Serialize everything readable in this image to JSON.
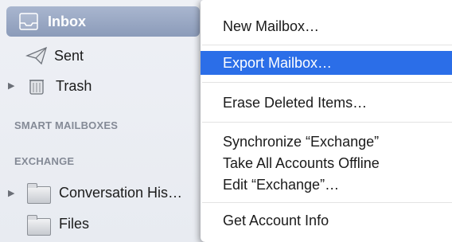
{
  "sidebar": {
    "inbox": {
      "label": "Inbox",
      "icon": "inbox-tray-icon"
    },
    "sent": {
      "label": "Sent",
      "icon": "paper-plane-icon"
    },
    "trash": {
      "label": "Trash",
      "icon": "trash-can-icon"
    },
    "smart_mailboxes_header": "SMART MAILBOXES",
    "exchange_header": "EXCHANGE",
    "conversation_history": {
      "label": "Conversation His…",
      "icon": "folder-icon"
    },
    "files": {
      "label": "Files",
      "icon": "folder-icon"
    }
  },
  "context_menu": {
    "items": [
      "New Mailbox…",
      "Export Mailbox…",
      "Erase Deleted Items…",
      "Synchronize “Exchange”",
      "Take All Accounts Offline",
      "Edit “Exchange”…",
      "Get Account Info"
    ],
    "highlighted": "Export Mailbox…",
    "highlight_color": "#2b6ee8"
  }
}
